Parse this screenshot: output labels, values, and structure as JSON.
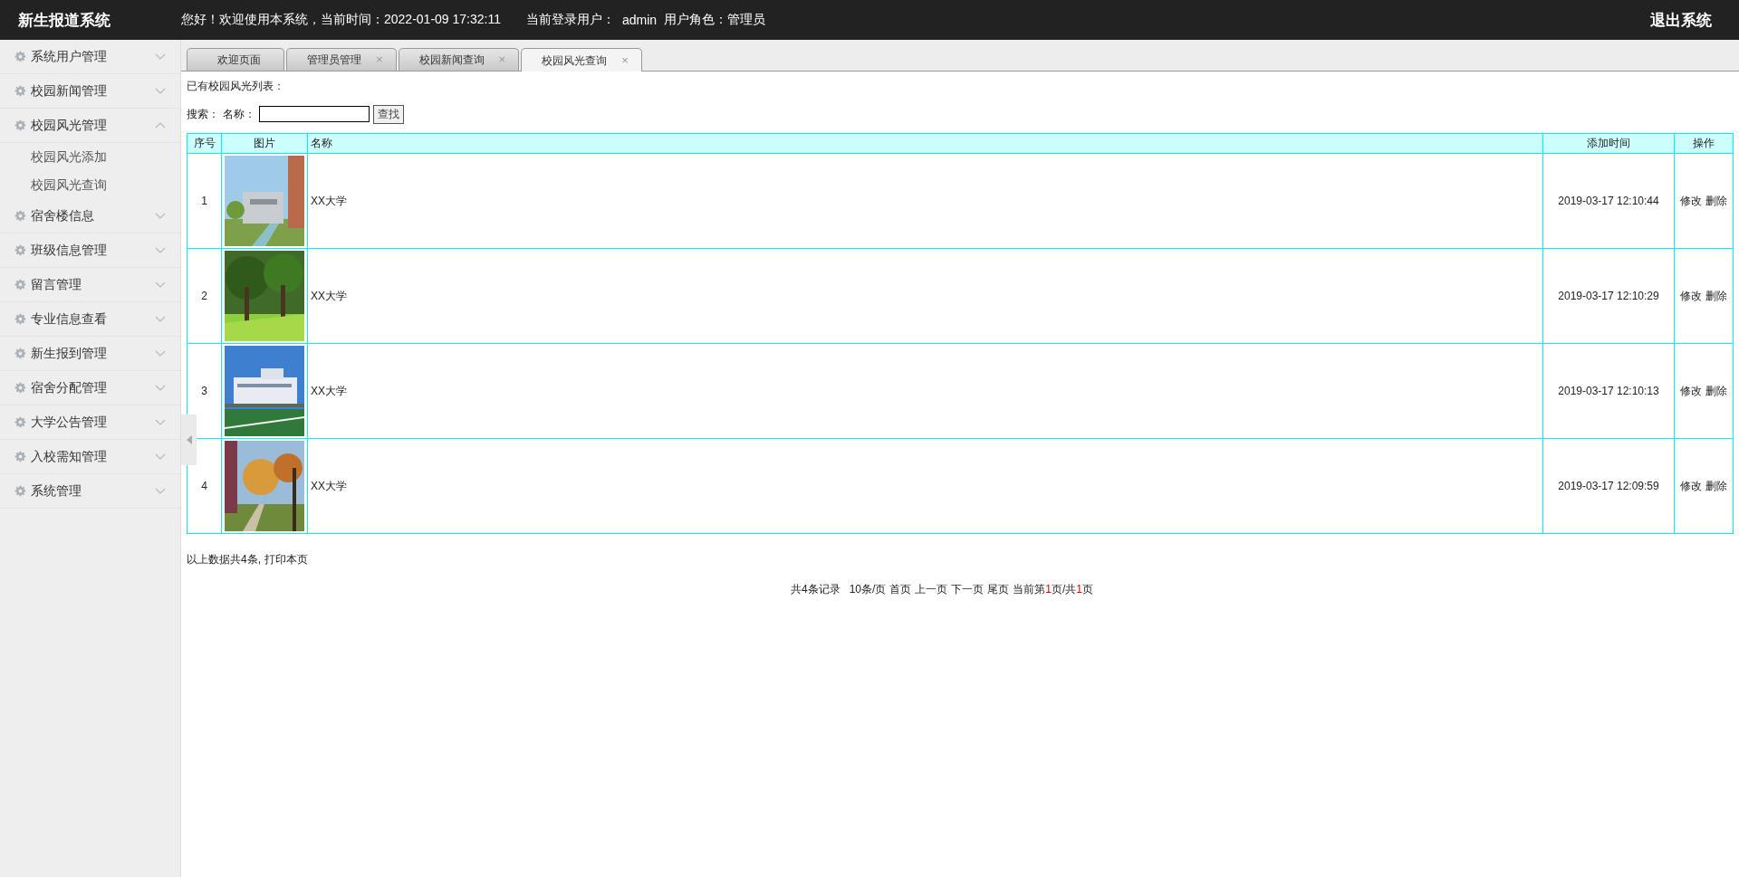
{
  "header": {
    "title": "新生报道系统",
    "greeting": "您好！欢迎使用本系统，当前时间：2022-01-09 17:32:11",
    "user_label": "当前登录用户：",
    "user": "admin",
    "role": "用户角色：管理员",
    "logout": "退出系统"
  },
  "sidebar": {
    "items": [
      {
        "label": "系统用户管理",
        "expanded": false
      },
      {
        "label": "校园新闻管理",
        "expanded": false
      },
      {
        "label": "校园风光管理",
        "expanded": true,
        "children": [
          {
            "label": "校园风光添加"
          },
          {
            "label": "校园风光查询"
          }
        ]
      },
      {
        "label": "宿舍楼信息",
        "expanded": false
      },
      {
        "label": "班级信息管理",
        "expanded": false
      },
      {
        "label": "留言管理",
        "expanded": false
      },
      {
        "label": "专业信息查看",
        "expanded": false
      },
      {
        "label": "新生报到管理",
        "expanded": false
      },
      {
        "label": "宿舍分配管理",
        "expanded": false
      },
      {
        "label": "大学公告管理",
        "expanded": false
      },
      {
        "label": "入校需知管理",
        "expanded": false
      },
      {
        "label": "系统管理",
        "expanded": false
      }
    ]
  },
  "tabs": [
    {
      "label": "欢迎页面",
      "selected": false
    },
    {
      "label": "管理员管理",
      "selected": false,
      "close": "×"
    },
    {
      "label": "校园新闻查询",
      "selected": false,
      "close": "×"
    },
    {
      "label": "校园风光查询",
      "selected": true,
      "close": "×"
    }
  ],
  "list_title": "已有校园风光列表：",
  "search": {
    "label": "搜索：",
    "field_label": "名称：",
    "button": "查找"
  },
  "table": {
    "columns": [
      "序号",
      "图片",
      "名称",
      "添加时间",
      "操作"
    ],
    "rows": [
      {
        "index": "1",
        "name": "XX大学",
        "time": "2019-03-17 12:10:44",
        "actions": [
          "修改",
          "删除"
        ]
      },
      {
        "index": "2",
        "name": "XX大学",
        "time": "2019-03-17 12:10:29",
        "actions": [
          "修改",
          "删除"
        ]
      },
      {
        "index": "3",
        "name": "XX大学",
        "time": "2019-03-17 12:10:13",
        "actions": [
          "修改",
          "删除"
        ]
      },
      {
        "index": "4",
        "name": "XX大学",
        "time": "2019-03-17 12:09:59",
        "actions": [
          "修改",
          "删除"
        ]
      }
    ]
  },
  "summary": {
    "text": "以上数据共4条,",
    "link": "打印本页"
  },
  "pager": {
    "total": "共4条记录",
    "per_page": "10条/页",
    "links": [
      "首页",
      "上一页",
      "下一页",
      "尾页"
    ],
    "position": [
      {
        "text": "当前第",
        "highlight": false
      },
      {
        "text": "1",
        "highlight": true
      },
      {
        "text": "页/共",
        "highlight": false
      },
      {
        "text": "1",
        "highlight": true
      },
      {
        "text": "页",
        "highlight": false
      }
    ]
  }
}
